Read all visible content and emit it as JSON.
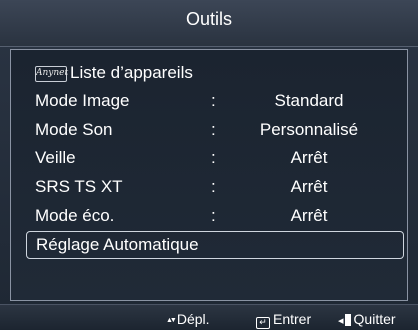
{
  "header": {
    "title": "Outils"
  },
  "menu": {
    "anynet": {
      "logo": "Anynet",
      "label": "Liste d’appareils"
    },
    "items": [
      {
        "label": "Mode Image",
        "sep": ":",
        "value": "Standard"
      },
      {
        "label": "Mode Son",
        "sep": ":",
        "value": "Personnalisé"
      },
      {
        "label": "Veille",
        "sep": ":",
        "value": "Arrêt"
      },
      {
        "label": "SRS TS XT",
        "sep": ":",
        "value": "Arrêt"
      },
      {
        "label": "Mode éco.",
        "sep": ":",
        "value": "Arrêt"
      }
    ],
    "selected": {
      "label": "Réglage Automatique"
    }
  },
  "footer": {
    "move": {
      "icon": "up-down-arrow-icon",
      "label": "Dépl."
    },
    "enter": {
      "icon": "enter-icon",
      "label": "Entrer"
    },
    "exit": {
      "icon": "exit-icon",
      "label": "Quitter"
    }
  },
  "colors": {
    "background": "#1f2936",
    "border": "#8a93a3",
    "text": "#ffffff"
  }
}
